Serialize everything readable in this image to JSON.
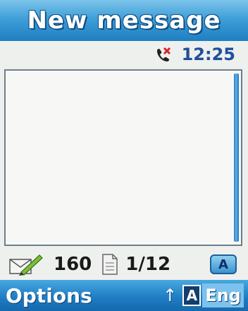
{
  "title": "New message",
  "status": {
    "icon": "missed-call-icon",
    "time": "12:25"
  },
  "editor": {
    "text": ""
  },
  "counters": {
    "chars_remaining": "160",
    "page": "1/12",
    "mode_badge": "A"
  },
  "softkeys": {
    "left": "Options",
    "shift_arrow": "↑",
    "input_mode": "A",
    "language": "Eng"
  },
  "colors": {
    "title_bar": "#3f9fd8",
    "softkey_bar": "#1f7ec4",
    "clock": "#1f4f9a",
    "background": "#eef0ee"
  }
}
